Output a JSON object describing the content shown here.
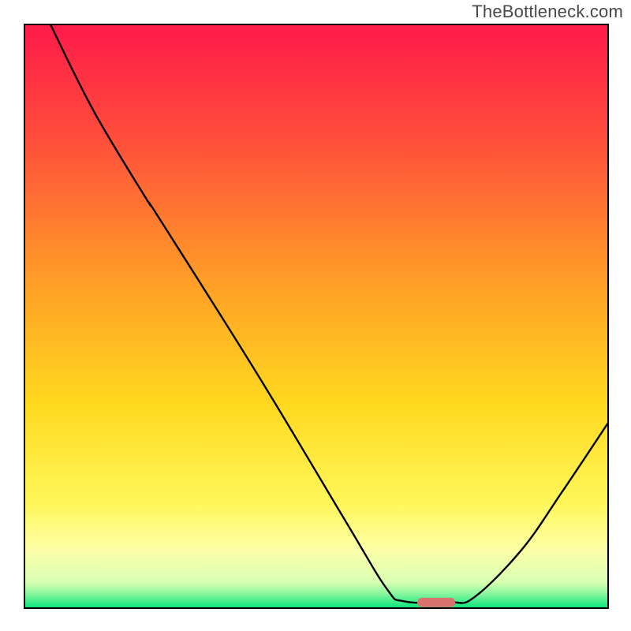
{
  "watermark": "TheBottleneck.com",
  "chart_data": {
    "type": "line",
    "title": "",
    "xlabel": "",
    "ylabel": "",
    "x_range": [
      0,
      100
    ],
    "y_range": [
      0,
      100
    ],
    "gradient_stops": [
      {
        "offset": 0,
        "color": "#ff1a4a"
      },
      {
        "offset": 0.2,
        "color": "#ff4f3b"
      },
      {
        "offset": 0.45,
        "color": "#ffa126"
      },
      {
        "offset": 0.65,
        "color": "#ffd91f"
      },
      {
        "offset": 0.82,
        "color": "#fff75a"
      },
      {
        "offset": 0.9,
        "color": "#fcffa8"
      },
      {
        "offset": 0.955,
        "color": "#d8ffb3"
      },
      {
        "offset": 0.975,
        "color": "#84f59d"
      },
      {
        "offset": 1.0,
        "color": "#00e57a"
      }
    ],
    "series": [
      {
        "name": "curve",
        "points": [
          {
            "x": 4.5,
            "y": 100
          },
          {
            "x": 12,
            "y": 85
          },
          {
            "x": 21,
            "y": 70
          },
          {
            "x": 23,
            "y": 67
          },
          {
            "x": 40,
            "y": 40
          },
          {
            "x": 55,
            "y": 15
          },
          {
            "x": 62,
            "y": 3.5
          },
          {
            "x": 65,
            "y": 1.3
          },
          {
            "x": 73,
            "y": 1.1
          },
          {
            "x": 77,
            "y": 2.0
          },
          {
            "x": 85,
            "y": 10
          },
          {
            "x": 92,
            "y": 20
          },
          {
            "x": 100,
            "y": 32
          }
        ]
      }
    ],
    "marker": {
      "x": 70.5,
      "y": 1.1,
      "w": 6.5,
      "h": 1.6,
      "color": "#d9736e"
    }
  }
}
